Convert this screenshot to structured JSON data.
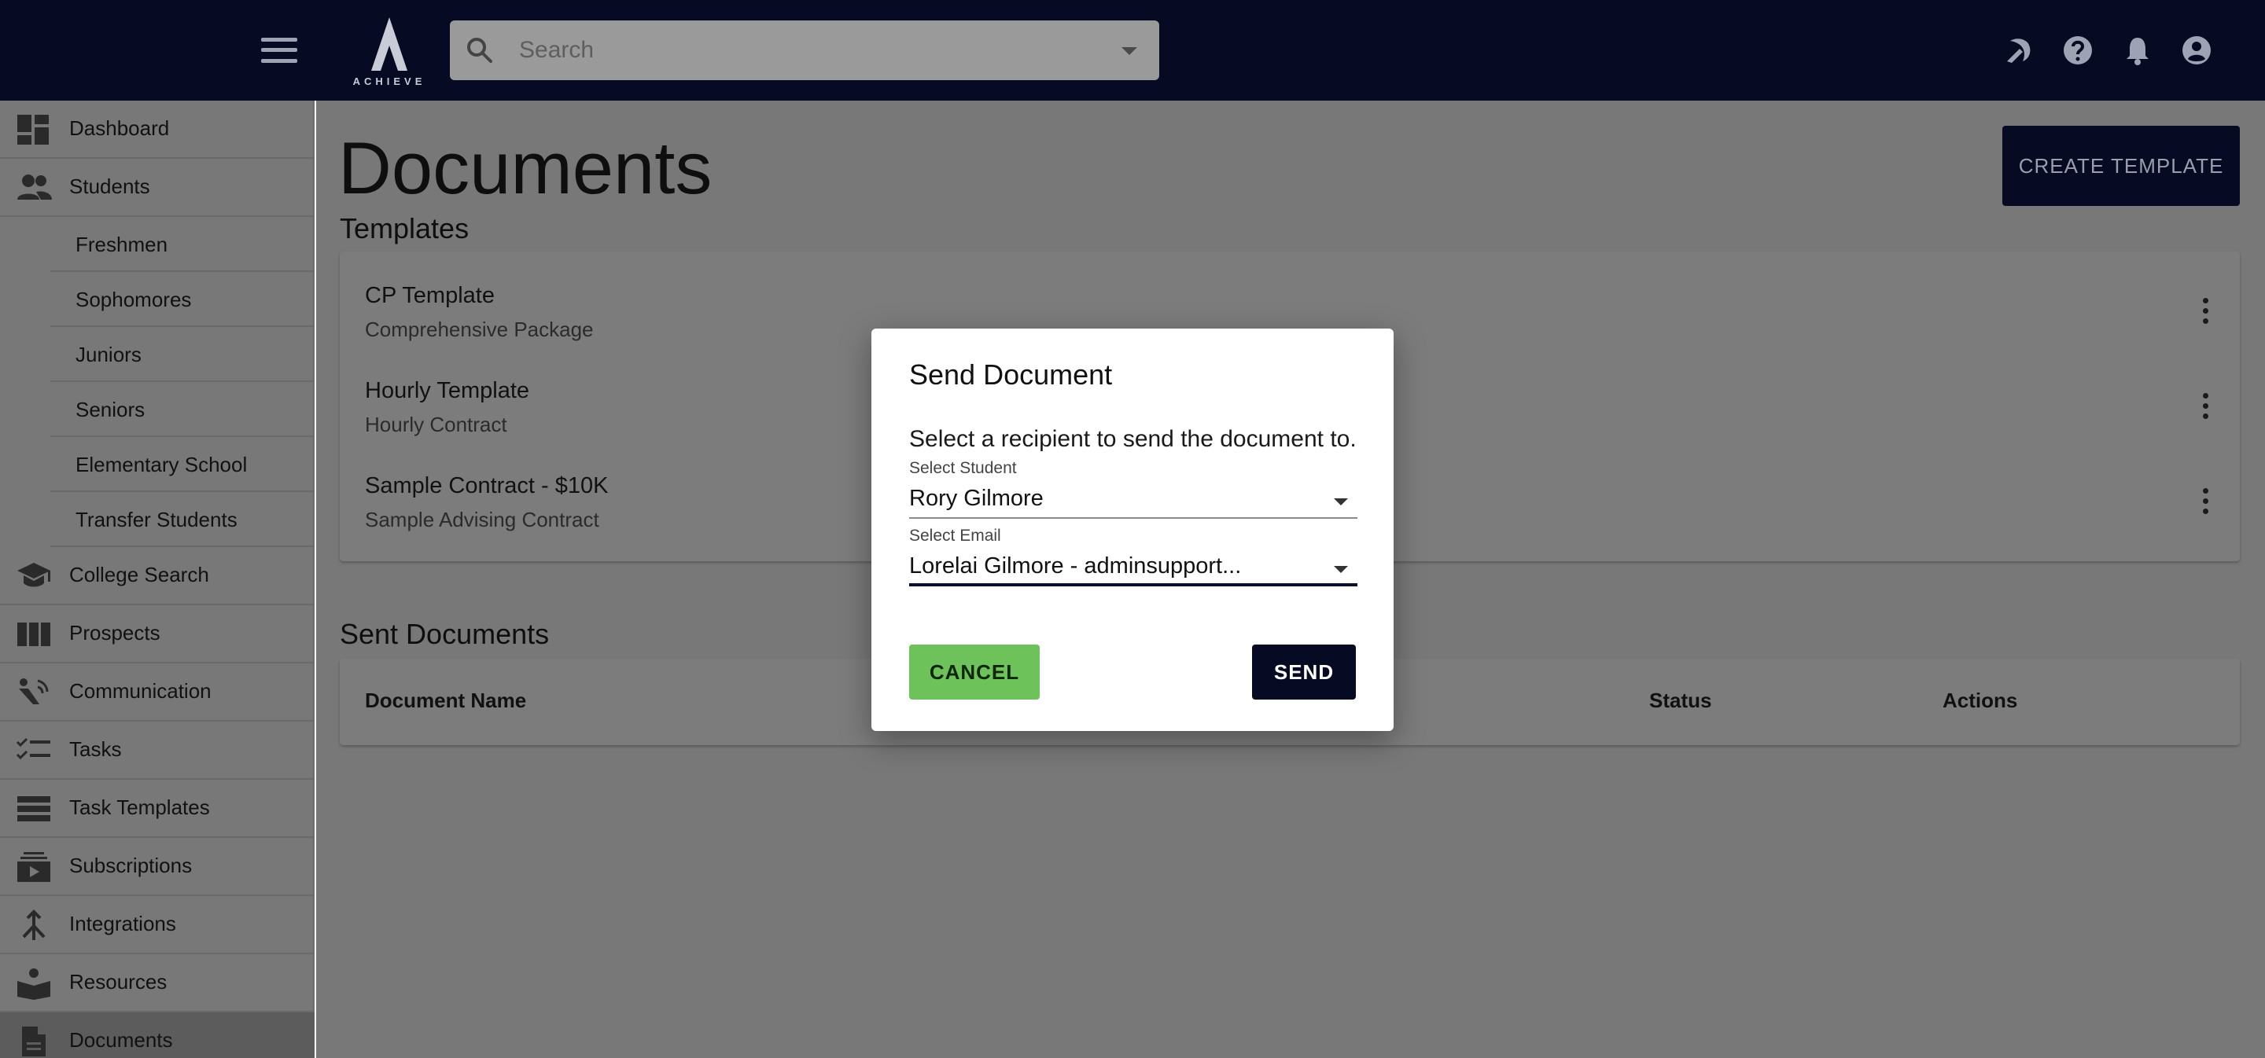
{
  "header": {
    "logo_text": "ACHIEVE",
    "search_placeholder": "Search",
    "icons": [
      "menu-icon",
      "dark-mode-icon",
      "help-icon",
      "notifications-icon",
      "account-icon"
    ]
  },
  "sidebar": {
    "items": [
      {
        "label": "Dashboard",
        "icon": "dashboard-icon"
      },
      {
        "label": "Students",
        "icon": "students-icon"
      },
      {
        "label": "Freshmen"
      },
      {
        "label": "Sophomores"
      },
      {
        "label": "Juniors"
      },
      {
        "label": "Seniors"
      },
      {
        "label": "Elementary School"
      },
      {
        "label": "Transfer Students"
      },
      {
        "label": "College Search",
        "icon": "graduation-cap-icon"
      },
      {
        "label": "Prospects",
        "icon": "columns-icon"
      },
      {
        "label": "Communication",
        "icon": "communication-icon"
      },
      {
        "label": "Tasks",
        "icon": "checklist-icon"
      },
      {
        "label": "Task Templates",
        "icon": "list-icon"
      },
      {
        "label": "Subscriptions",
        "icon": "subscriptions-icon"
      },
      {
        "label": "Integrations",
        "icon": "merge-icon"
      },
      {
        "label": "Resources",
        "icon": "book-icon"
      },
      {
        "label": "Documents",
        "icon": "document-icon",
        "active": true
      }
    ]
  },
  "main": {
    "title": "Documents",
    "create_button": "CREATE TEMPLATE",
    "templates_heading": "Templates",
    "templates": [
      {
        "name": "CP Template",
        "description": "Comprehensive Package"
      },
      {
        "name": "Hourly Template",
        "description": "Hourly Contract"
      },
      {
        "name": "Sample Contract - $10K",
        "description": "Sample Advising Contract"
      }
    ],
    "sent_heading": "Sent Documents",
    "sent_columns": [
      "Document Name",
      "Status",
      "Actions"
    ]
  },
  "dialog": {
    "title": "Send Document",
    "text": "Select a recipient to send the document to.",
    "student_label": "Select Student",
    "student_value": "Rory Gilmore",
    "email_label": "Select Email",
    "email_value": "Lorelai Gilmore  - adminsupport...",
    "cancel": "CANCEL",
    "send": "SEND"
  },
  "colors": {
    "navy": "#060a23",
    "cancel_green": "#6dc25a",
    "overlay_gray": "#787878"
  }
}
